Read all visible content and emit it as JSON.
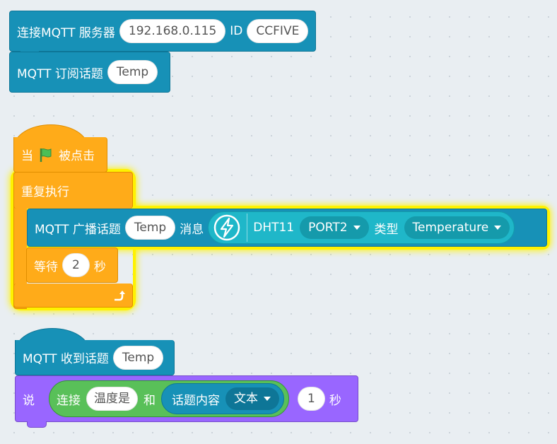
{
  "connect_block": {
    "label": "连接MQTT 服务器",
    "server": "192.168.0.115",
    "id_label": "ID",
    "id_value": "CCFIVE"
  },
  "subscribe_block": {
    "label": "MQTT 订阅话题",
    "topic": "Temp"
  },
  "flag_hat": {
    "when": "当",
    "clicked": "被点击"
  },
  "repeat_block": {
    "label": "重复执行"
  },
  "publish_block": {
    "label": "MQTT 广播话题",
    "topic": "Temp",
    "message_label": "消息",
    "sensor": "DHT11",
    "port": "PORT2",
    "type_label": "类型",
    "type_value": "Temperature"
  },
  "wait_block": {
    "label": "等待",
    "value": "2",
    "unit": "秒"
  },
  "receive_hat": {
    "label": "MQTT 收到话题",
    "topic": "Temp"
  },
  "say_block": {
    "label": "说",
    "join_label": "连接",
    "join_text": "温度是",
    "join_and": "和",
    "content_label": "话题内容",
    "content_type": "文本",
    "seconds": "1",
    "unit": "秒"
  },
  "colors": {
    "teal": "#1791b7",
    "orange": "#ffab19",
    "purple": "#9966ff",
    "green": "#59c059",
    "highlight": "#fff200"
  },
  "icons": {
    "flag": "green-flag-icon",
    "sensor": "lightning-icon",
    "loop": "loop-arrow-icon"
  }
}
